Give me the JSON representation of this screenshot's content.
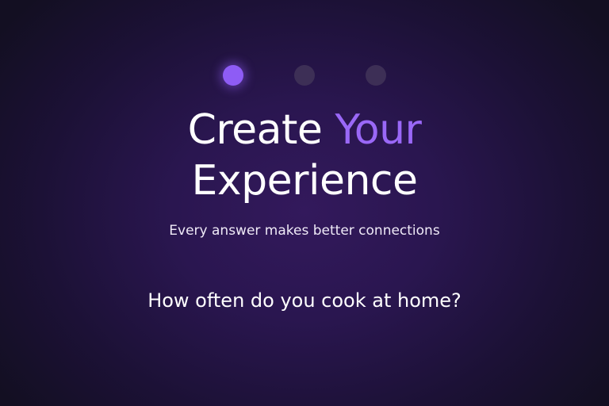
{
  "progress": {
    "steps_total": 3,
    "current_step": 1,
    "active_color": "#8e5cf5",
    "inactive_color": "#3d2f56"
  },
  "headline": {
    "line1_prefix": "Create",
    "line1_accent": "Your",
    "line2": "Experience",
    "accent_color": "#9a68f7"
  },
  "subtitle": "Every answer makes better connections",
  "question": "How often do you cook at home?"
}
